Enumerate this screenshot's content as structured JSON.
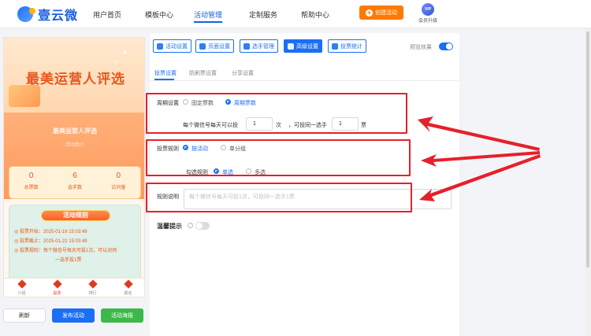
{
  "header": {
    "logo_text": "壹云微",
    "nav": [
      "用户首页",
      "模板中心",
      "活动管理",
      "定制服务",
      "帮助中心"
    ],
    "create_button": "创建活动",
    "vip_badge": "VIP",
    "vip_label": "会员升级"
  },
  "phone": {
    "banner_title": "最美运营人评选",
    "activity_title": "最美运营人评选",
    "activity_sub": "活动简介",
    "stats": [
      {
        "value": "0",
        "label": "总票数"
      },
      {
        "value": "6",
        "label": "选手数"
      },
      {
        "value": "0",
        "label": "访问量"
      }
    ],
    "rules_title": "活动规则",
    "rules": {
      "start": "◎ 投票开始：2025-01-16 15:03:49",
      "end": "◎ 投票截止：2025-01-22 15:03:49",
      "rule1": "◎ 投票规则：每个微信号每天可投1次，可以对同",
      "rule2": "一选手投1票"
    },
    "tabs": [
      "介绍",
      "投票",
      "排行",
      "报名"
    ]
  },
  "bottom_buttons": {
    "refresh": "刷新",
    "publish": "发布活动",
    "poster": "活动海报"
  },
  "toolbar": {
    "items": [
      "活动设置",
      "页面设置",
      "选手管理",
      "高级设置",
      "投票统计"
    ],
    "preview_label": "预览效果"
  },
  "subtabs": [
    "投票设置",
    "防刷票设置",
    "分享设置"
  ],
  "form": {
    "cycle_label": "周期设置",
    "cycle_fixed": "固定票数",
    "cycle_recurring": "周期票数",
    "per_day_prefix": "每个微信号每天可以投",
    "per_day_value": "1",
    "per_day_unit": "次",
    "same_player_prefix": "，可投同一选手",
    "same_player_value": "1",
    "same_player_unit": "票",
    "rule_label": "投票规则",
    "rule_by_activity": "按活动",
    "rule_by_group": "单分组",
    "check_label": "勾选规则",
    "check_single": "单选",
    "check_multi": "多选",
    "desc_label": "规则说明",
    "desc_placeholder": "每个微信号每天可投1次，可投同一选手1票",
    "tip_label": "温馨提示",
    "tip_help": "?"
  },
  "colors": {
    "primary": "#1a6ff5",
    "accent_orange": "#ff7a00",
    "highlight_red": "#e6202a",
    "success_green": "#3cb94a"
  }
}
